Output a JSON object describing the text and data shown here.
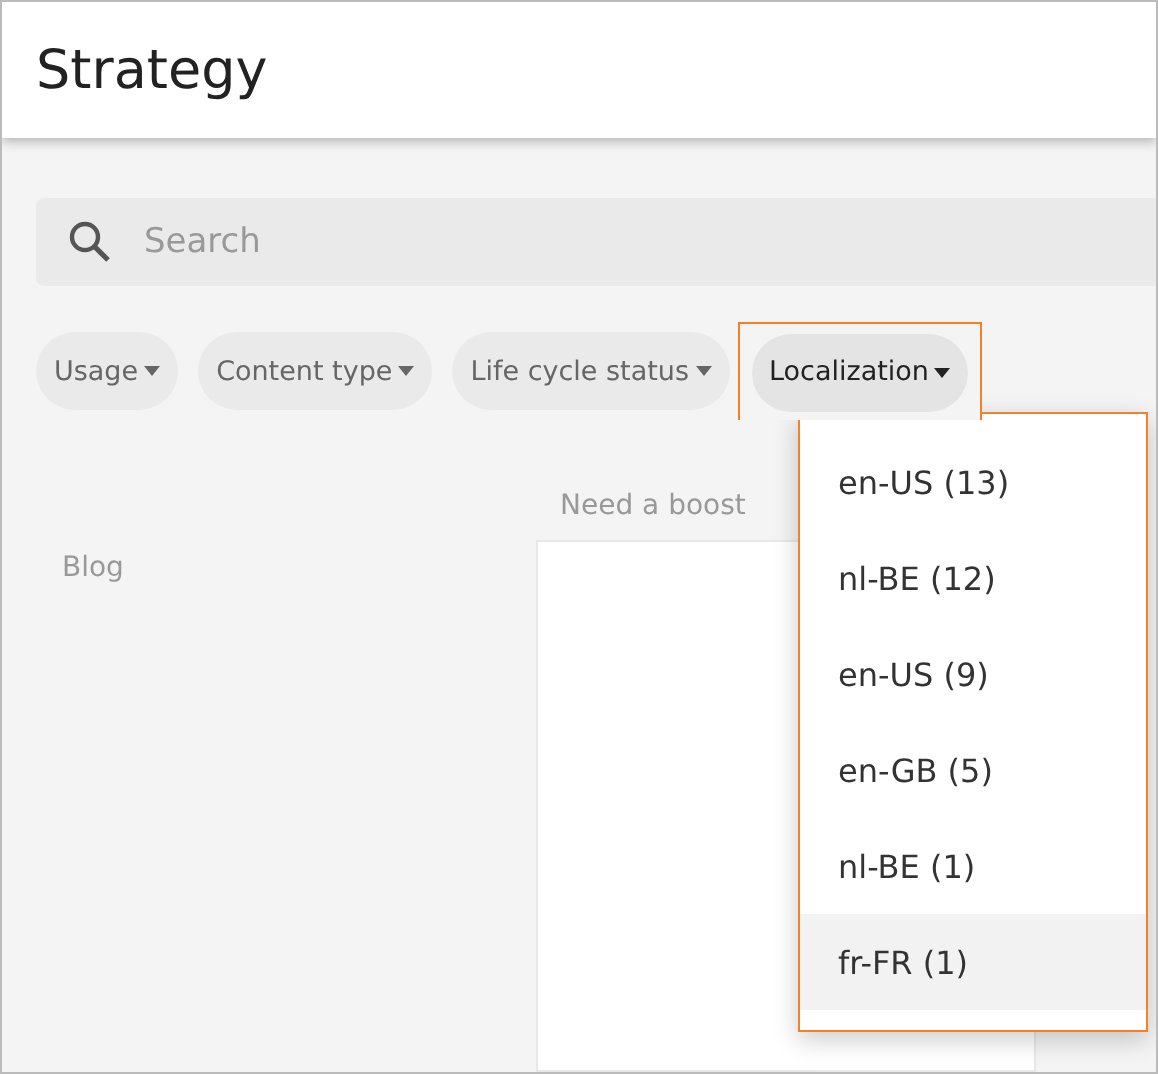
{
  "header": {
    "title": "Strategy"
  },
  "search": {
    "placeholder": "Search"
  },
  "filters": [
    {
      "label": "Usage",
      "open": false
    },
    {
      "label": "Content type",
      "open": false
    },
    {
      "label": "Life cycle status",
      "open": false
    },
    {
      "label": "Localization",
      "open": true
    }
  ],
  "dropdown": {
    "options": [
      {
        "label": "en-US (13)",
        "highlighted": false
      },
      {
        "label": "nl-BE (12)",
        "highlighted": false
      },
      {
        "label": "en-US (9)",
        "highlighted": false
      },
      {
        "label": "en-GB (5)",
        "highlighted": false
      },
      {
        "label": "nl-BE (1)",
        "highlighted": false
      },
      {
        "label": "fr-FR (1)",
        "highlighted": true
      }
    ]
  },
  "board": {
    "column_header": "Need a boost",
    "row_label": "Blog"
  }
}
